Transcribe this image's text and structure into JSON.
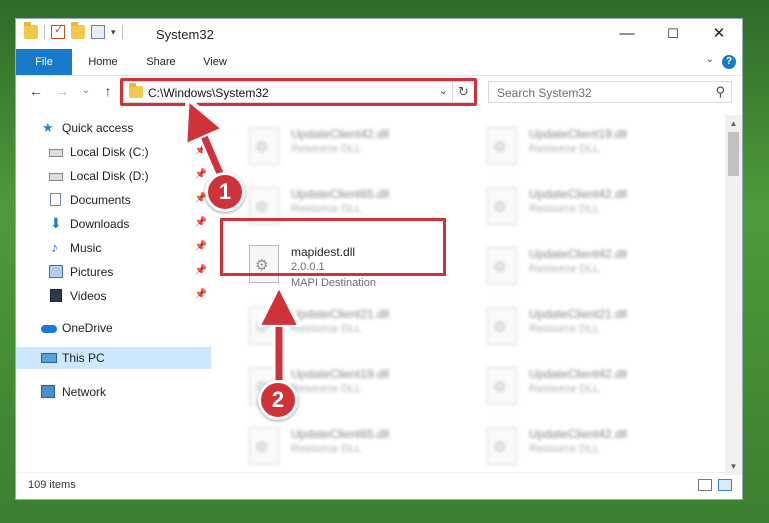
{
  "window": {
    "title": "System32",
    "controls": {
      "minimize": "—",
      "maximize": "☐",
      "close": "✕"
    }
  },
  "ribbon": {
    "tabs": [
      {
        "label": "File"
      },
      {
        "label": "Home"
      },
      {
        "label": "Share"
      },
      {
        "label": "View"
      }
    ],
    "help_label": "?"
  },
  "address": {
    "path": "C:\\Windows\\System32",
    "search_placeholder": "Search System32"
  },
  "nav": {
    "items": [
      {
        "label": "Quick access",
        "icon": "star-icon"
      },
      {
        "label": "Local Disk (C:)",
        "icon": "drive-icon",
        "pinned": true
      },
      {
        "label": "Local Disk (D:)",
        "icon": "drive-icon",
        "pinned": true
      },
      {
        "label": "Documents",
        "icon": "document-icon",
        "pinned": true
      },
      {
        "label": "Downloads",
        "icon": "download-icon",
        "pinned": true
      },
      {
        "label": "Music",
        "icon": "music-icon",
        "pinned": true
      },
      {
        "label": "Pictures",
        "icon": "picture-icon",
        "pinned": true
      },
      {
        "label": "Videos",
        "icon": "video-icon",
        "pinned": true
      },
      {
        "label": "OneDrive",
        "icon": "cloud-icon"
      },
      {
        "label": "This PC",
        "icon": "computer-icon",
        "selected": true
      },
      {
        "label": "Network",
        "icon": "network-icon"
      }
    ]
  },
  "files": {
    "left": [
      {
        "name": "UpdateClient42.dll",
        "type": "Resource DLL"
      },
      {
        "name": "UpdateClient65.dll",
        "type": "Resource DLL"
      },
      {
        "name": "mapidest.dll",
        "version": "2.0.0.1",
        "type": "MAPI Destination"
      },
      {
        "name": "UpdateClient21.dll",
        "type": "Resource DLL"
      },
      {
        "name": "UpdateClient19.dll",
        "type": "Resource DLL"
      },
      {
        "name": "UpdateClient65.dll",
        "type": "Resource DLL"
      }
    ],
    "right": [
      {
        "name": "UpdateClient19.dll",
        "type": "Resource DLL"
      },
      {
        "name": "UpdateClient42.dll",
        "type": "Resource DLL"
      },
      {
        "name": "UpdateClient42.dll",
        "type": "Resource DLL"
      },
      {
        "name": "UpdateClient21.dll",
        "type": "Resource DLL"
      },
      {
        "name": "UpdateClient42.dll",
        "type": "Resource DLL"
      },
      {
        "name": "UpdateClient42.dll",
        "type": "Resource DLL"
      }
    ]
  },
  "status": {
    "item_count": "109 items"
  },
  "callouts": {
    "one": "1",
    "two": "2"
  },
  "colors": {
    "accent": "#1979ca",
    "highlight": "#d0323a",
    "selection": "#cce8ff"
  }
}
